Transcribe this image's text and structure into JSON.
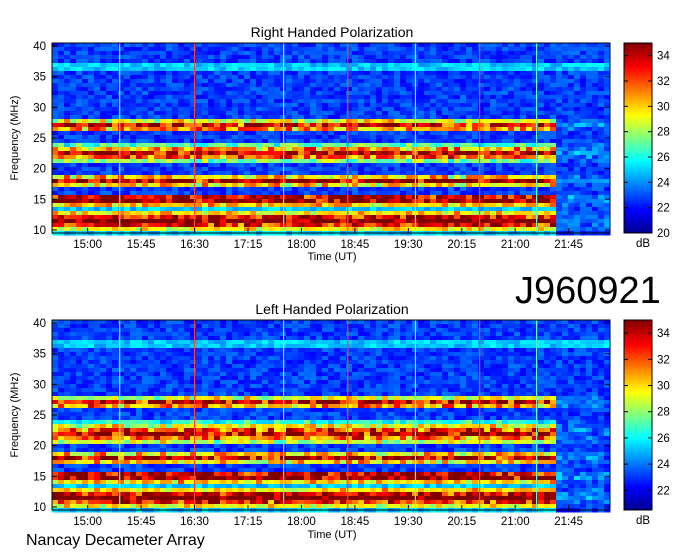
{
  "figure": {
    "observation_id": "J960921",
    "footer": "Nancay Decameter Array"
  },
  "chart_data": [
    {
      "type": "heatmap",
      "title": "Right Handed Polarization",
      "xlabel": "Time (UT)",
      "ylabel": "Frequency (MHz)",
      "x_range_hours": [
        14.5,
        22.33
      ],
      "ylim": [
        9.5,
        40.5
      ],
      "x_ticks": [
        "15:00",
        "15:45",
        "16:30",
        "17:15",
        "18:00",
        "18:45",
        "19:30",
        "20:15",
        "21:00",
        "21:45"
      ],
      "y_ticks": [
        10,
        15,
        20,
        25,
        30,
        35,
        40
      ],
      "colorbar": {
        "label": "dB",
        "range": [
          20,
          35
        ],
        "ticks": [
          20,
          22,
          24,
          26,
          28,
          30,
          32,
          34
        ]
      },
      "colors": [
        "#00008f",
        "#0000ff",
        "#00ffff",
        "#ffff00",
        "#ff0000",
        "#800000"
      ],
      "emission_bands_mhz": [
        [
          10,
          13
        ],
        [
          14,
          16
        ],
        [
          17,
          19
        ],
        [
          21,
          24
        ],
        [
          26,
          28
        ]
      ],
      "emission_end_hour": 21.5
    },
    {
      "type": "heatmap",
      "title": "Left Handed Polarization",
      "xlabel": "Time (UT)",
      "ylabel": "Frequency (MHz)",
      "x_range_hours": [
        14.5,
        22.33
      ],
      "ylim": [
        9.5,
        40.5
      ],
      "x_ticks": [
        "15:00",
        "15:45",
        "16:30",
        "17:15",
        "18:00",
        "18:45",
        "19:30",
        "20:15",
        "21:00",
        "21:45"
      ],
      "y_ticks": [
        10,
        15,
        20,
        25,
        30,
        35,
        40
      ],
      "colorbar": {
        "label": "dB",
        "range": [
          20.5,
          35
        ],
        "ticks": [
          22,
          24,
          26,
          28,
          30,
          32,
          34
        ]
      },
      "colors": [
        "#00008f",
        "#0000ff",
        "#00ffff",
        "#ffff00",
        "#ff0000",
        "#800000"
      ],
      "emission_bands_mhz": [
        [
          10,
          13
        ],
        [
          14,
          16
        ],
        [
          17,
          19
        ],
        [
          20,
          24
        ],
        [
          26,
          28
        ]
      ],
      "emission_end_hour": 21.5
    }
  ]
}
